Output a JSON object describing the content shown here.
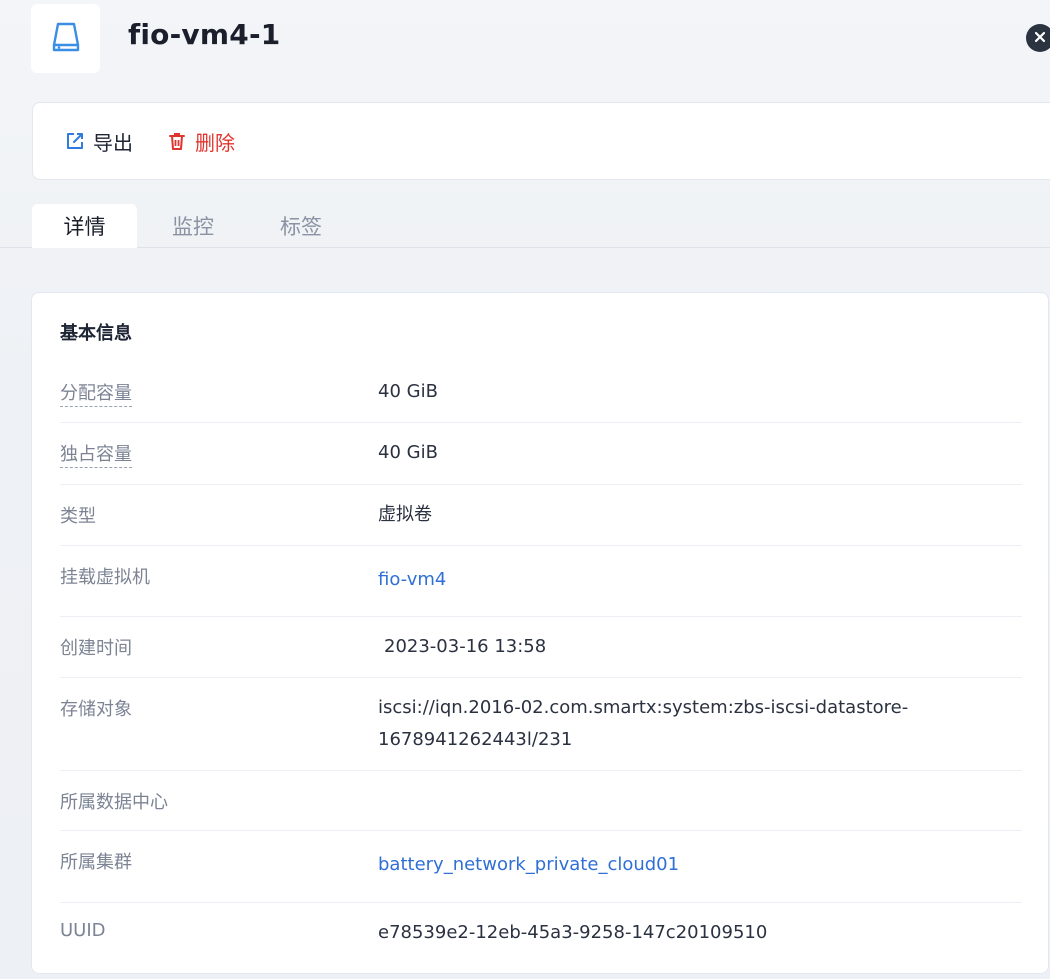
{
  "header": {
    "title": "fio-vm4-1",
    "icon": "disk-icon",
    "close_icon": "close-icon"
  },
  "toolbar": {
    "export_label": "导出",
    "export_icon": "external-link-icon",
    "delete_label": "删除",
    "delete_icon": "trash-icon"
  },
  "tabs": [
    {
      "label": "详情",
      "active": true
    },
    {
      "label": "监控",
      "active": false
    },
    {
      "label": "标签",
      "active": false
    }
  ],
  "basic_info": {
    "title": "基本信息",
    "rows": [
      {
        "label": "分配容量",
        "value": "40 GiB"
      },
      {
        "label": "独占容量",
        "value": "40 GiB"
      },
      {
        "label": "类型",
        "value": "虚拟卷"
      },
      {
        "label": "挂载虚拟机",
        "value": "fio-vm4"
      },
      {
        "label": "创建时间",
        "value": "2023-03-16 13:58"
      },
      {
        "label": "存储对象",
        "value_line1": "iscsi://iqn.2016-02.com.smartx:system:zbs-iscsi-datastore-",
        "value_line2": "1678941262443l/231"
      },
      {
        "label": "所属数据中心",
        "value": ""
      },
      {
        "label": "所属集群",
        "value": "battery_network_private_cloud01"
      },
      {
        "label": "UUID",
        "value": "e78539e2-12eb-45a3-9258-147c20109510"
      }
    ]
  },
  "colors": {
    "link": "#2f6fd6",
    "danger": "#e0352f",
    "accent_icon": "#3a8ee6"
  }
}
